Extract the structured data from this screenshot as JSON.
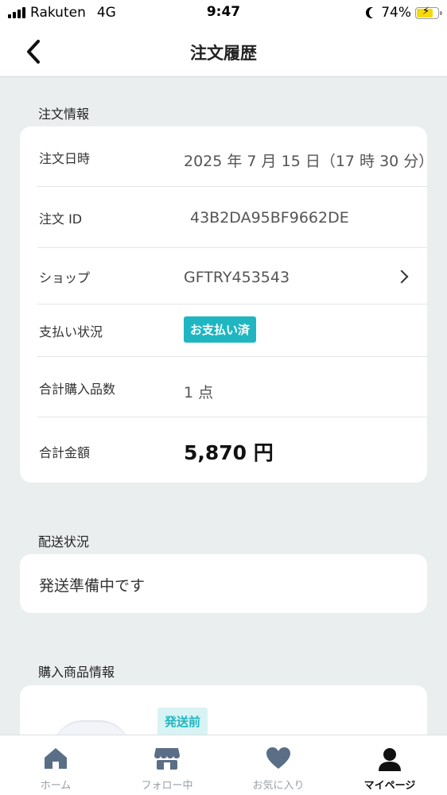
{
  "status_bar": {
    "carrier": "Rakuten",
    "network": "4G",
    "time": "9:47",
    "battery": "74%"
  },
  "header": {
    "title": "注文履歴",
    "back_icon": "chevron-left-icon"
  },
  "order_info": {
    "section_label": "注文情報",
    "rows": [
      {
        "label": "注文日時",
        "value": "2025 年 7 月 15 日（17 時 30 分）"
      },
      {
        "label": "注文 ID",
        "value": "43B2DA95BF9662DE"
      },
      {
        "label": "ショップ",
        "value": "GFTRY453543"
      },
      {
        "label": "支払い状況",
        "value": "お支払い済"
      },
      {
        "label": "合計購入品数",
        "value": "1 点"
      },
      {
        "label": "合計金額",
        "value": "5,870 円"
      }
    ],
    "badge_color": "#1fb6c1"
  },
  "delivery": {
    "section_label": "配送状況",
    "status": "発送準備中です"
  },
  "products": {
    "section_label": "購入商品情報",
    "item_status_badge": "発送前"
  },
  "tabbar": {
    "items": [
      {
        "label": "ホーム",
        "icon": "home-icon"
      },
      {
        "label": "フォロー中",
        "icon": "store-icon"
      },
      {
        "label": "お気に入り",
        "icon": "heart-icon"
      },
      {
        "label": "マイページ",
        "icon": "person-icon",
        "active": true
      }
    ]
  },
  "colors": {
    "accent": "#1fb6c1",
    "background": "#ebeeef",
    "tab_inactive": "#9aa0a6"
  }
}
